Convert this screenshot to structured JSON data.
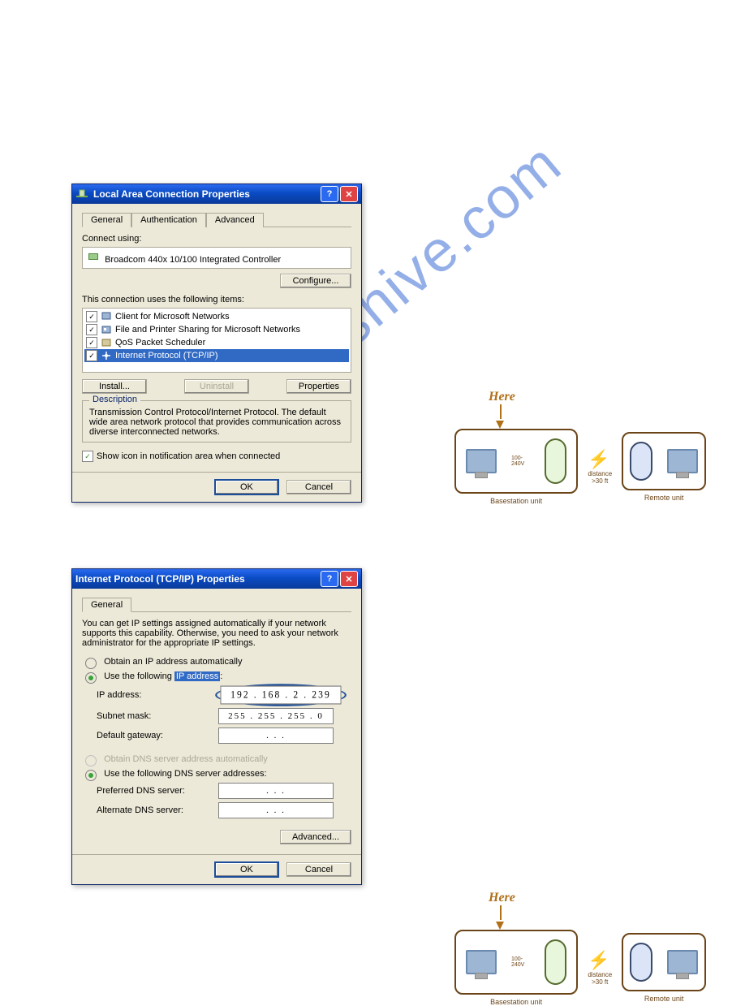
{
  "dialog1": {
    "title": "Local Area Connection Properties",
    "tabs": [
      "General",
      "Authentication",
      "Advanced"
    ],
    "connect_using_label": "Connect using:",
    "adapter": "Broadcom 440x 10/100 Integrated Controller",
    "configure_btn": "Configure...",
    "items_label": "This connection uses the following items:",
    "items": [
      {
        "checked": true,
        "label": "Client for Microsoft Networks",
        "icon": "client"
      },
      {
        "checked": true,
        "label": "File and Printer Sharing for Microsoft Networks",
        "icon": "share"
      },
      {
        "checked": true,
        "label": "QoS Packet Scheduler",
        "icon": "qos"
      },
      {
        "checked": true,
        "label": "Internet Protocol (TCP/IP)",
        "icon": "proto",
        "selected": true
      }
    ],
    "install_btn": "Install...",
    "uninstall_btn": "Uninstall",
    "properties_btn": "Properties",
    "description_legend": "Description",
    "description_text": "Transmission Control Protocol/Internet Protocol. The default wide area network protocol that provides communication across diverse interconnected networks.",
    "show_icon_label": "Show icon in notification area when connected",
    "show_icon_checked": true,
    "ok_btn": "OK",
    "cancel_btn": "Cancel"
  },
  "dialog2": {
    "title": "Internet Protocol (TCP/IP) Properties",
    "tab": "General",
    "intro": "You can get IP settings assigned automatically if your network supports this capability. Otherwise, you need to ask your network administrator for the appropriate IP settings.",
    "opt_auto_ip": "Obtain an IP address automatically",
    "opt_static_ip": "Use the following IP address:",
    "opt_static_ip_highlight": "IP address",
    "ip_label": "IP address:",
    "ip_value": "192 . 168 .   2  . 239",
    "subnet_label": "Subnet mask:",
    "subnet_value": "255 . 255 . 255 .   0",
    "gateway_label": "Default gateway:",
    "gateway_value": ".        .        .",
    "opt_auto_dns": "Obtain DNS server address automatically",
    "opt_static_dns": "Use the following DNS server addresses:",
    "pref_dns_label": "Preferred DNS server:",
    "pref_dns_value": ".        .        .",
    "alt_dns_label": "Alternate DNS server:",
    "alt_dns_value": ".        .        .",
    "advanced_btn": "Advanced...",
    "ok_btn": "OK",
    "cancel_btn": "Cancel"
  },
  "diagram": {
    "here": "Here",
    "basestation": "Basestation unit",
    "remote": "Remote unit",
    "distance": "distance >30 ft",
    "voltage": "100-240V"
  },
  "watermark": "manualshive.com"
}
